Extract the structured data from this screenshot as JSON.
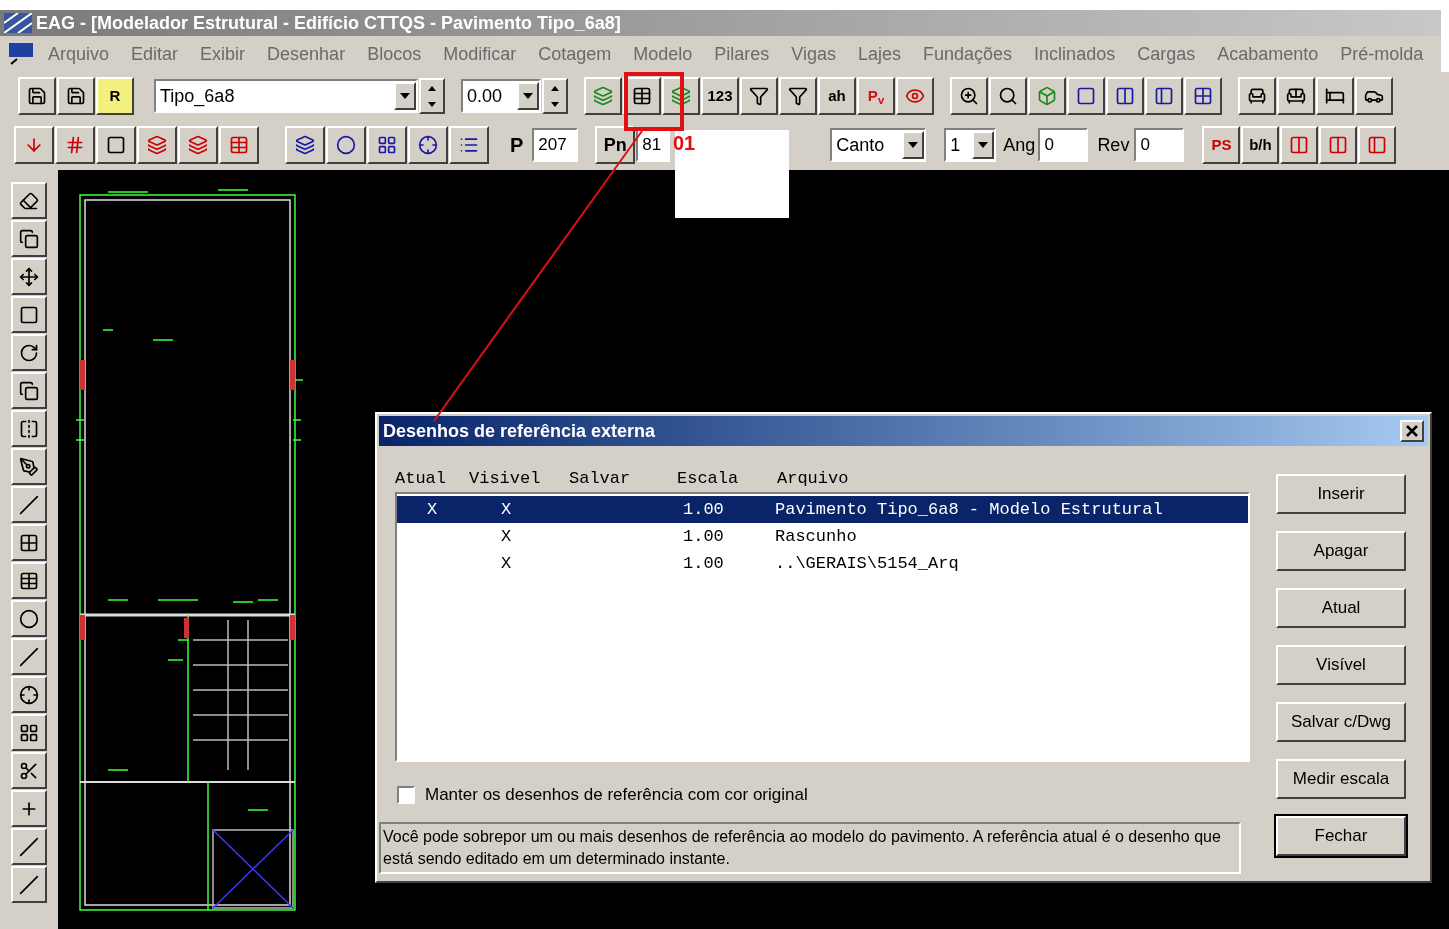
{
  "window": {
    "title": "EAG - [Modelador Estrutural - Edifício CTTQS - Pavimento Tipo_6a8]"
  },
  "menu": [
    "Arquivo",
    "Editar",
    "Exibir",
    "Desenhar",
    "Blocos",
    "Modificar",
    "Cotagem",
    "Modelo",
    "Pilares",
    "Vigas",
    "Lajes",
    "Fundações",
    "Inclinados",
    "Cargas",
    "Acabamento",
    "Pré-molda"
  ],
  "toolbar1": {
    "floor": "Tipo_6a8",
    "elevation": "0.00",
    "labels": [
      "R",
      "123",
      "ah",
      "P$_{v}$"
    ]
  },
  "toolbar2": {
    "p_label": "P",
    "p_value": "207",
    "pn_label": "Pn",
    "pn_value": "81",
    "position": "Canto",
    "count": "1",
    "ang_label": "Ang",
    "ang_value": "0",
    "rev_label": "Rev",
    "rev_value": "0",
    "labels": [
      "PS",
      "b/h"
    ]
  },
  "annotation": {
    "label": "01"
  },
  "dialog": {
    "title": "Desenhos de referência externa",
    "columns": [
      "Atual",
      "Visivel",
      "Salvar",
      "Escala",
      "Arquivo"
    ],
    "rows": [
      {
        "atual": "X",
        "visivel": "X",
        "escala": "1.00",
        "arquivo": "Pavimento Tipo_6a8 - Modelo Estrutural",
        "selected": true
      },
      {
        "visivel": "X",
        "escala": "1.00",
        "arquivo": "Rascunho",
        "selected": false
      },
      {
        "visivel": "X",
        "escala": "1.00",
        "arquivo": "..\\GERAIS\\5154_Arq",
        "selected": false
      }
    ],
    "checkbox": {
      "label": "Manter os desenhos de referência com cor original",
      "checked": false
    },
    "help": "Você pode sobrepor um ou mais desenhos de referência ao modelo do pavimento. A referência atual é o desenho que está sendo editado em um determinado instante.",
    "buttons": [
      {
        "label": "Inserir",
        "default": false
      },
      {
        "label": "Apagar",
        "default": false
      },
      {
        "label": "Atual",
        "default": false
      },
      {
        "label": "Visível",
        "default": false
      },
      {
        "label": "Salvar c/Dwg",
        "default": false
      },
      {
        "label": "Medir escala",
        "default": false
      },
      {
        "label": "Fechar",
        "default": true
      }
    ]
  }
}
